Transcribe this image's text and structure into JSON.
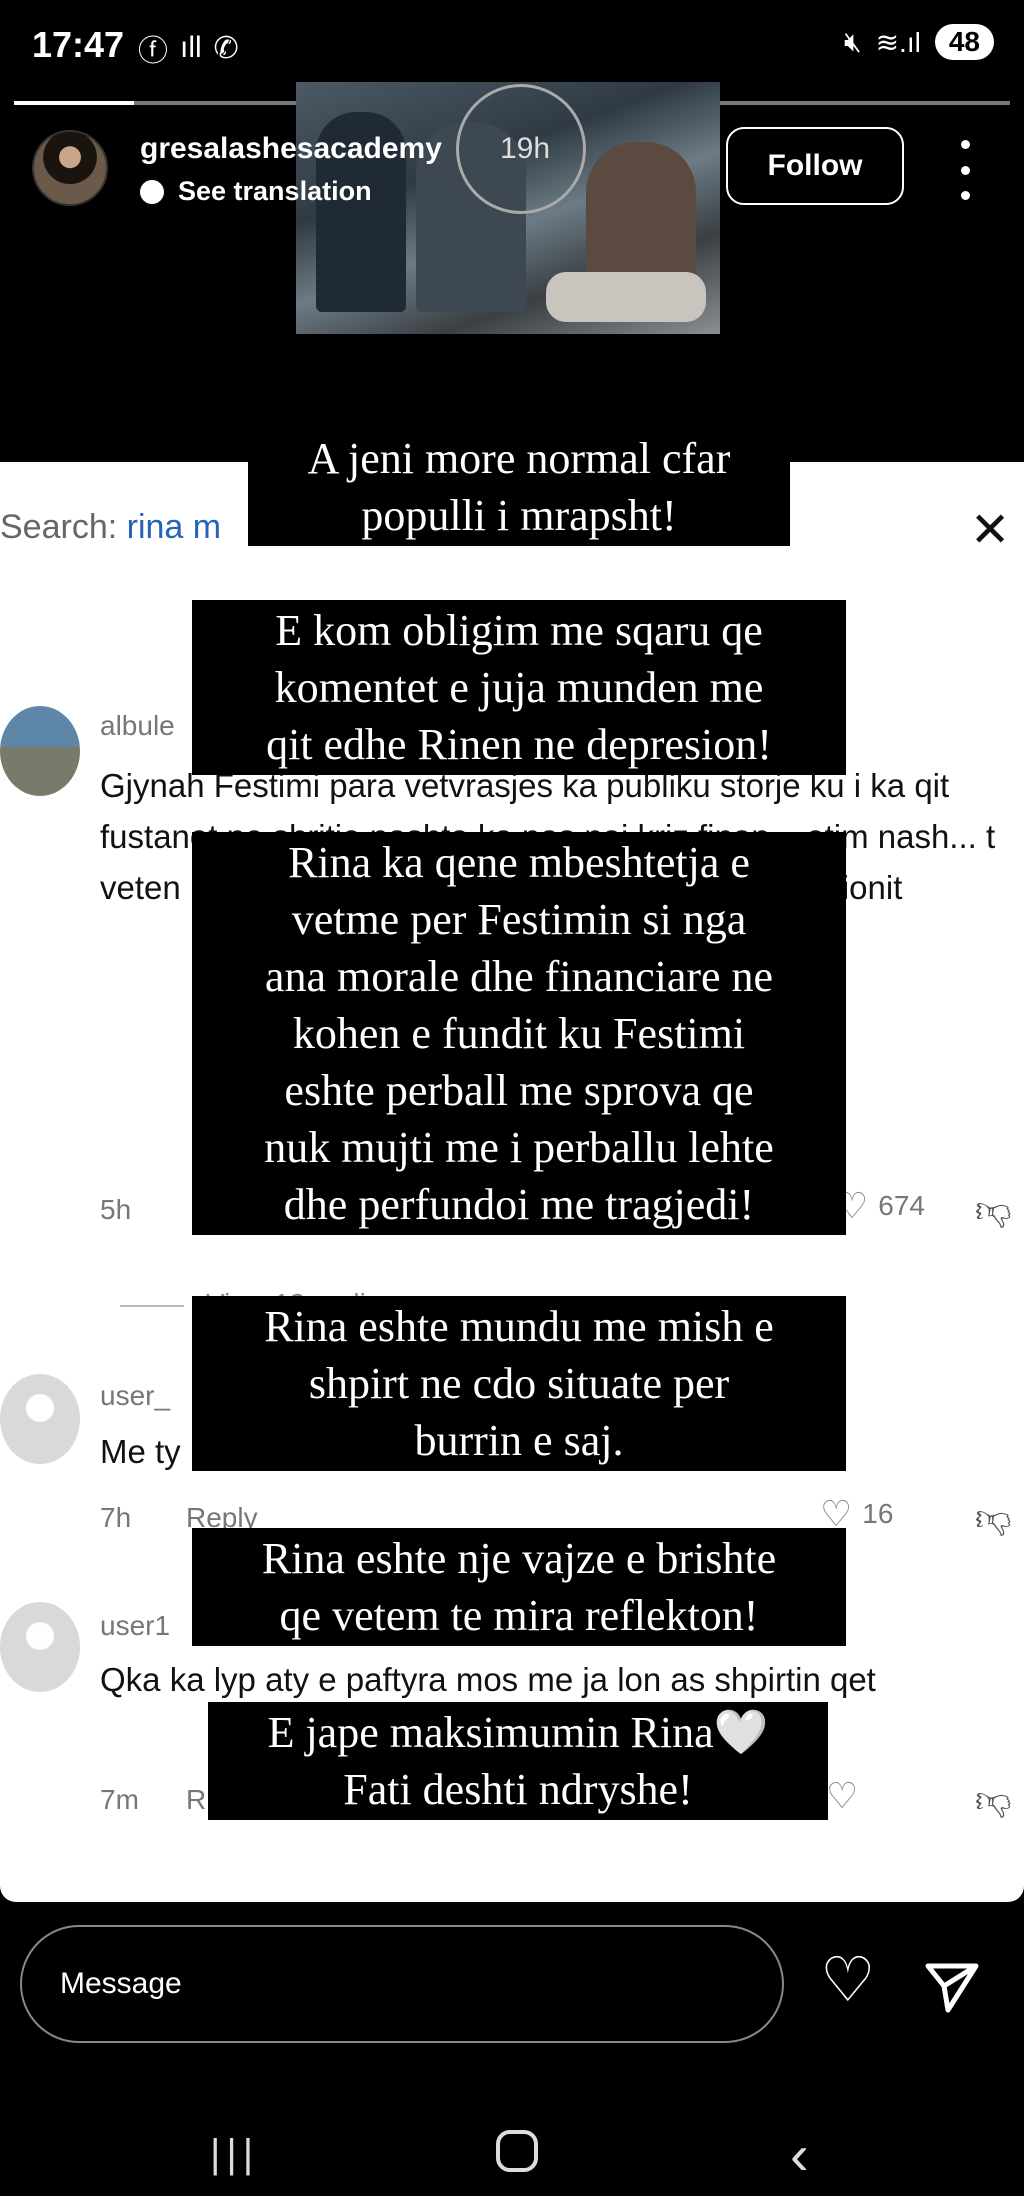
{
  "status_bar": {
    "time": "17:47",
    "battery": "48"
  },
  "story": {
    "username": "gresalashesacademy",
    "time_ago": "19h",
    "see_translation": "See translation",
    "follow_label": "Follow",
    "progress": 0.12
  },
  "screenshot": {
    "search_prefix": "Search: ",
    "search_query": "rina m",
    "comments": [
      {
        "user": "albule",
        "text": "Gjynah Festimi para vetvrasjes ka publiku storje ku i ka qit fustanet ne shritje nashta ka pas naj kriz finan... etim nash... t veten kjo k... ka godit n'dor... u se shum njerz... resionit",
        "time": "5h",
        "likes": "674",
        "view_replies": "View 13 replies"
      },
      {
        "user": "user_",
        "text": "Me ty",
        "time": "7h",
        "reply": "Reply",
        "likes": "16"
      },
      {
        "user": "user1",
        "text": "Qka ka lyp aty e paftyra mos me ja lon as shpirtin qet",
        "time": "7m",
        "reply": "R"
      }
    ]
  },
  "captions": [
    "A jeni more normal cfar\npopulli i mrapsht!",
    "E kom obligim me sqaru qe\nkomentet e juja munden me\nqit edhe Rinen ne depresion!",
    "Rina ka qene mbeshtetja e\nvetme per Festimin si nga\nana morale dhe financiare ne\nkohen e fundit ku Festimi\neshte perball me sprova qe\nnuk mujti me i perballu lehte\ndhe perfundoi me tragjedi!",
    "Rina eshte mundu me mish e\nshpirt ne cdo situate per\nburrin e saj.",
    "Rina eshte nje vajze e brishte\nqe vetem te mira reflekton!",
    "E jape maksimumin Rina🤍\nFati deshti ndryshe!"
  ],
  "bottom": {
    "message_placeholder": "Message"
  },
  "icons": {
    "facebook": "facebook-icon",
    "signal": "signal-icon",
    "whatsapp": "whatsapp-icon",
    "mute": "mute-icon",
    "wifi": "wifi-icon",
    "more": "more-vertical-icon",
    "close": "close-icon",
    "heart": "heart-icon",
    "dislike": "dislike-icon",
    "send": "send-icon"
  }
}
